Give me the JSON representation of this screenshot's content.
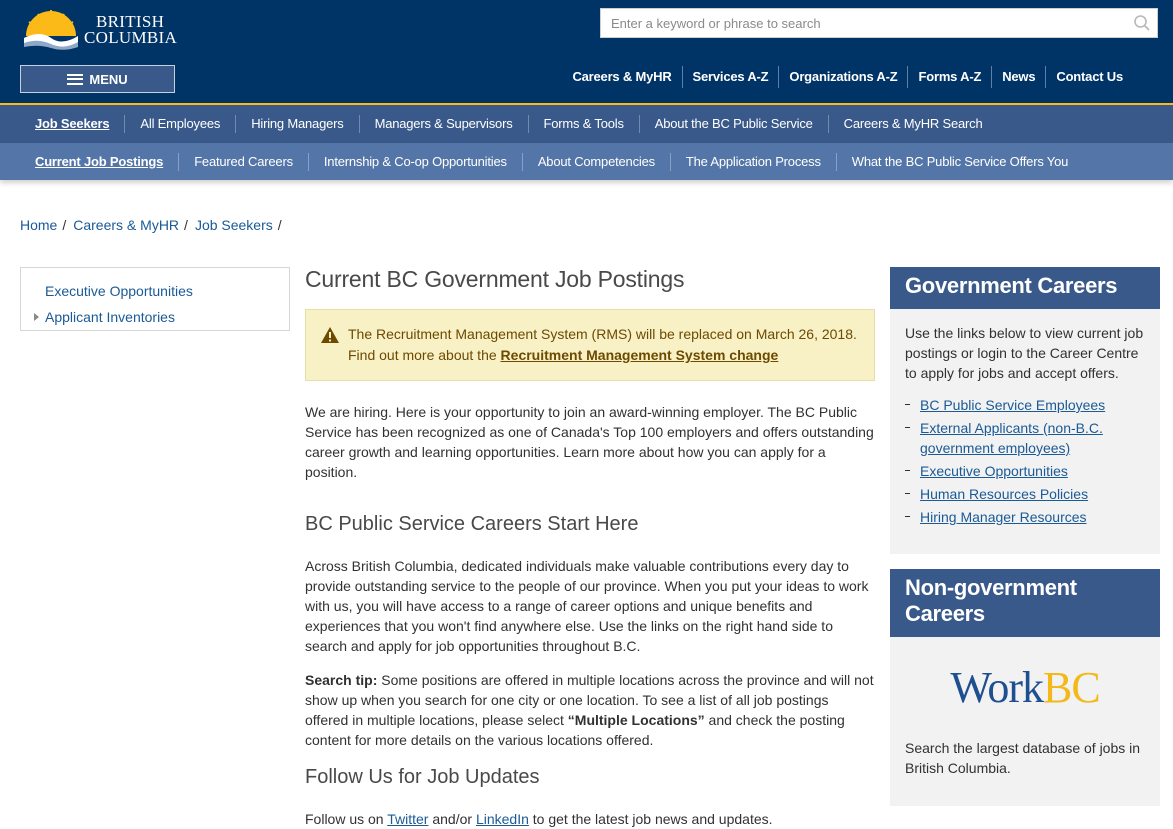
{
  "header": {
    "logo_line1": "BRITISH",
    "logo_line2": "COLUMBIA",
    "search_placeholder": "Enter a keyword or phrase to search",
    "menu_label": "MENU",
    "utility_links": [
      "Careers & MyHR",
      "Services A-Z",
      "Organizations A-Z",
      "Forms A-Z",
      "News",
      "Contact Us"
    ]
  },
  "primary_nav": {
    "items": [
      "Job Seekers",
      "All Employees",
      "Hiring Managers",
      "Managers & Supervisors",
      "Forms & Tools",
      "About the BC Public Service",
      "Careers & MyHR Search"
    ],
    "active_index": 0
  },
  "secondary_nav": {
    "items": [
      "Current Job Postings",
      "Featured Careers",
      "Internship & Co-op Opportunities",
      "About Competencies",
      "The Application Process",
      "What the BC Public Service Offers You"
    ],
    "active_index": 0
  },
  "breadcrumb": [
    "Home",
    "Careers & MyHR",
    "Job Seekers"
  ],
  "side_nav": {
    "items": [
      "Executive Opportunities",
      "Applicant Inventories"
    ]
  },
  "main": {
    "title": "Current BC Government Job Postings",
    "alert_line1": "The Recruitment Management System (RMS) will be replaced on March 26, 2018.",
    "alert_line2_prefix": "Find out more about the ",
    "alert_link": "Recruitment Management System change",
    "intro": "We are hiring. Here is your opportunity to join an award-winning employer. The BC Public Service has been recognized as one of Canada's Top 100 employers and offers outstanding career growth and learning opportunities. Learn more about how you can apply for a position.",
    "heading_start": "BC Public Service Careers Start Here",
    "across": "Across British Columbia, dedicated individuals make valuable contributions every day to provide outstanding service to the people of our province. When you put your ideas to work with us, you will have access to a range of career options and unique benefits and experiences that you won't find anywhere else. Use the links on the right hand side to search and apply for job opportunities throughout B.C.",
    "tip_label": "Search tip:",
    "tip_text1": " Some positions are offered in multiple locations across the province and will not show up when you search for one city or one location. To see a list of all job postings offered in multiple locations, please select ",
    "tip_bold": "“Multiple Locations”",
    "tip_text2": " and check the posting content for more details on the various locations offered.",
    "heading_follow": "Follow Us for Job Updates",
    "follow_prefix": "Follow us on ",
    "follow_twitter": "Twitter",
    "follow_mid": " and/or ",
    "follow_linkedin": "LinkedIn",
    "follow_suffix": " to get the latest job news and updates."
  },
  "sidebar": {
    "gov_title": "Government Careers",
    "gov_desc": "Use the links below to view current job postings or login to the Career Centre to apply for jobs and accept offers.",
    "gov_links": [
      "BC Public Service Employees",
      "External Applicants (non-B.C. government employees)",
      "Executive Opportunities",
      "Human Resources Policies",
      "Hiring Manager Resources"
    ],
    "nongov_title": "Non-government Careers",
    "workbc_part1": "Work",
    "workbc_part2": "BC",
    "nongov_desc": "Search the largest database of jobs in British Columbia."
  },
  "colors": {
    "header_bg": "#003366",
    "primary_nav_bg": "#38598a",
    "secondary_nav_bg": "#5475a7",
    "accent_gold": "#fcba19",
    "link": "#1a5a96",
    "alert_bg": "#f9f1c6"
  },
  "icons": [
    "search-icon",
    "menu-icon",
    "warning-icon",
    "bc-sun-logo-icon",
    "triangle-right-icon"
  ]
}
